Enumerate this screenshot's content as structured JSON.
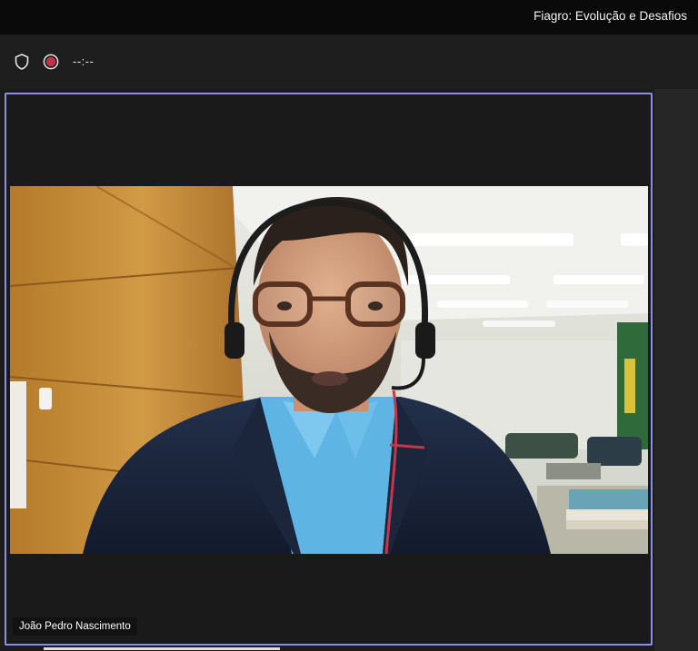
{
  "window": {
    "title": "Fiagro: Evolução e Desafios"
  },
  "toolbar": {
    "timer": "--:--"
  },
  "participant": {
    "name": "João Pedro Nascimento"
  },
  "colors": {
    "active_speaker_border": "#8b8ee8",
    "record_indicator": "#c4314b"
  }
}
